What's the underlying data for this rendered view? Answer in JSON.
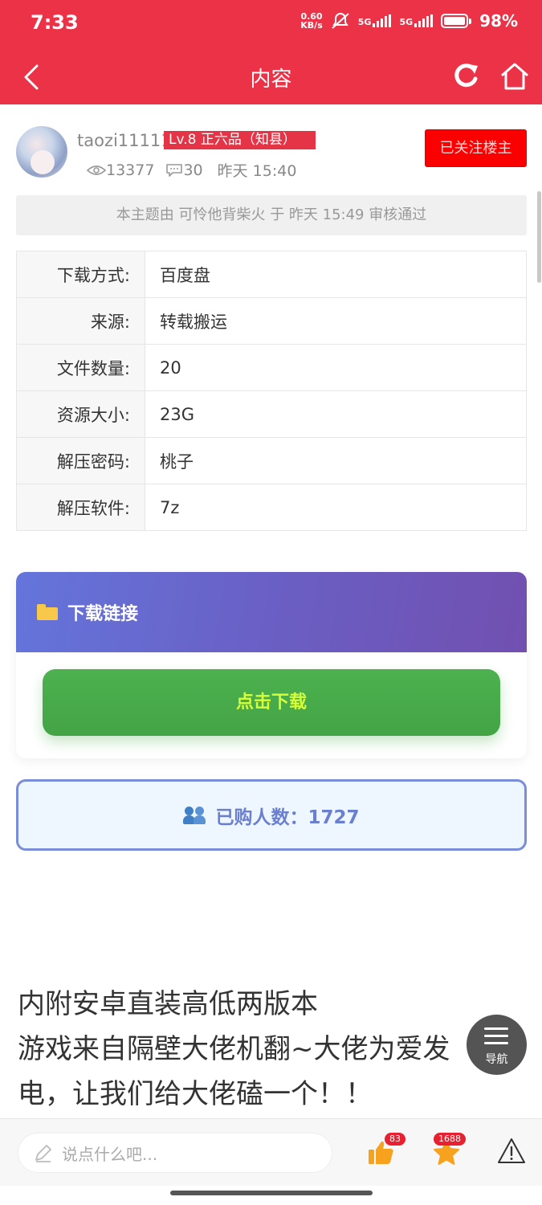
{
  "status": {
    "time": "7:33",
    "net_speed_value": "0.60",
    "net_speed_unit": "KB/s",
    "signal1": "5G",
    "signal2": "5G",
    "battery": "98%",
    "battery_level": 0.98
  },
  "nav": {
    "title": "内容"
  },
  "post": {
    "username": "taozi111111",
    "level": "Lv.8 正六品（知县）",
    "views": "13377",
    "comments": "30",
    "time": "昨天 15:40",
    "follow_label": "已关注楼主",
    "review_note": "本主题由 可怜他背柴火 于 昨天 15:49 审核通过"
  },
  "info_table": [
    {
      "key": "下载方式:",
      "value": "百度盘"
    },
    {
      "key": "来源:",
      "value": "转载搬运"
    },
    {
      "key": "文件数量:",
      "value": "20"
    },
    {
      "key": "资源大小:",
      "value": "23G"
    },
    {
      "key": "解压密码:",
      "value": "桃子"
    },
    {
      "key": "解压软件:",
      "value": "7z"
    }
  ],
  "download": {
    "header": "下载链接",
    "button": "点击下载"
  },
  "buyers": {
    "label": "已购人数：1727"
  },
  "content": {
    "lines": [
      "内附安卓直装高低两版本",
      "游戏来自隔壁大佬机翻~大佬为爱发",
      "电，让我们给大佬磕一个！！"
    ]
  },
  "float_nav": {
    "label": "导航"
  },
  "bottom": {
    "comment_placeholder": "说点什么吧...",
    "like_count": "83",
    "fav_count": "1688"
  },
  "colors": {
    "brand": "#ec3247",
    "download_green": "#4caf50",
    "buyers_accent": "#6a7fd0"
  }
}
